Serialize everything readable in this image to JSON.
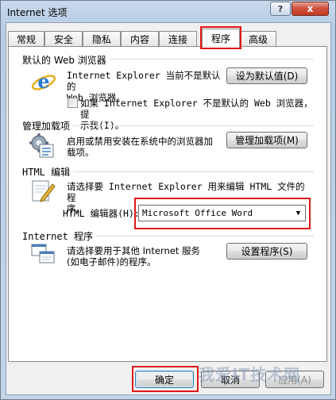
{
  "window": {
    "title": "Internet 选项",
    "help_label": "?",
    "close_label": "x"
  },
  "tabs": [
    {
      "label": "常规"
    },
    {
      "label": "安全"
    },
    {
      "label": "隐私"
    },
    {
      "label": "内容"
    },
    {
      "label": "连接"
    },
    {
      "label": "程序"
    },
    {
      "label": "高级"
    }
  ],
  "active_tab": "程序",
  "default_browser": {
    "title": "默认的 Web 浏览器",
    "text_line1": "Internet Explorer 当前不是默认的",
    "text_line2": "Web 浏览器。",
    "button": "设为默认值(D)",
    "checkbox_line1": "如果 Internet Explorer 不是默认的 Web 浏览器，提",
    "checkbox_line2": "示我(I)。",
    "checkbox_checked": false
  },
  "addons": {
    "title": "管理加载项",
    "text_line1": "启用或禁用安装在系统中的浏览器加",
    "text_line2": "载项。",
    "button": "管理加载项(M)"
  },
  "html_editing": {
    "title": "HTML 编辑",
    "text_line1": "请选择要 Internet Explorer 用来编辑 HTML 文件的程",
    "text_line2": "序。",
    "editor_label": "HTML 编辑器(H):",
    "editor_value": "Microsoft Office Word"
  },
  "internet_programs": {
    "title": "Internet 程序",
    "text_line1": "请选择要用于其他 Internet 服务",
    "text_line2": "(如电子邮件)的程序。",
    "button": "设置程序(S)"
  },
  "footer": {
    "ok": "确定",
    "cancel": "取消",
    "apply": "应用(A)"
  },
  "watermark": "我爱IT技术网"
}
